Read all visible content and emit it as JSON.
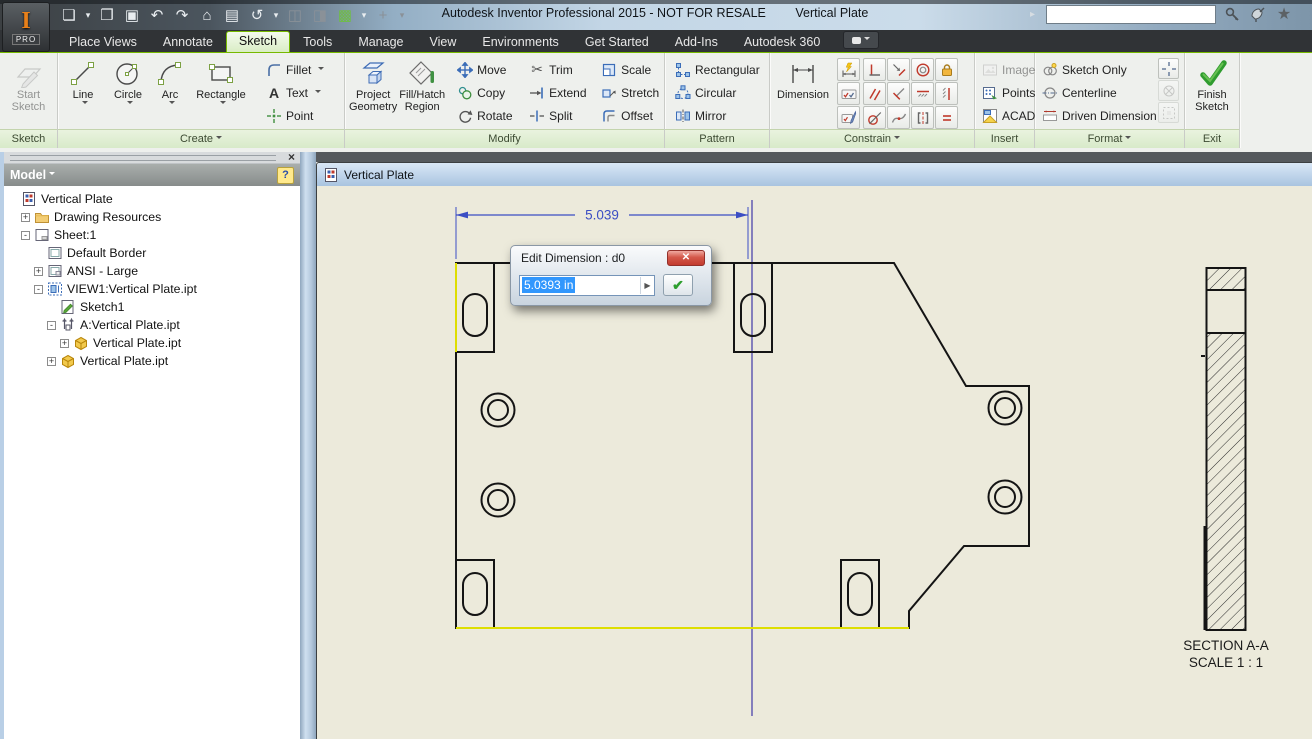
{
  "titlebar": {
    "app_name": "Autodesk Inventor Professional 2015 - NOT FOR RESALE",
    "doc_name": "Vertical Plate",
    "logo_letter": "I",
    "logo_sub": "PRO",
    "qat": [
      {
        "name": "new-file",
        "glyph": "❏"
      },
      {
        "name": "open-file",
        "glyph": "❒"
      },
      {
        "name": "save",
        "glyph": "▣"
      },
      {
        "name": "undo",
        "glyph": "↶"
      },
      {
        "name": "redo",
        "glyph": "↷"
      },
      {
        "name": "home",
        "glyph": "⌂"
      },
      {
        "name": "print",
        "glyph": "▤"
      },
      {
        "name": "update",
        "glyph": "↺"
      },
      {
        "name": "switch-window",
        "glyph": "◫"
      },
      {
        "name": "appearance",
        "glyph": "◨"
      },
      {
        "name": "component",
        "glyph": "▩"
      },
      {
        "name": "add-tool",
        "glyph": "+"
      },
      {
        "name": "customize-qat",
        "glyph": "▾"
      }
    ],
    "search": {
      "value": "",
      "go_glyph": "▸",
      "star_glyph": "★"
    }
  },
  "tabs": {
    "items": [
      "Place Views",
      "Annotate",
      "Sketch",
      "Tools",
      "Manage",
      "View",
      "Environments",
      "Get Started",
      "Add-Ins",
      "Autodesk 360"
    ],
    "active": "Sketch"
  },
  "ribbon": {
    "sketch": {
      "start": "Start Sketch",
      "footer": "Sketch"
    },
    "create": {
      "line": "Line",
      "circle": "Circle",
      "arc": "Arc",
      "rectangle": "Rectangle",
      "fillet": "Fillet",
      "text": "Text",
      "point": "Point",
      "text_glyph": "A",
      "footer": "Create"
    },
    "modify": {
      "project": "Project Geometry",
      "fill": "Fill/Hatch Region",
      "move": "Move",
      "copy": "Copy",
      "rotate": "Rotate",
      "trim": "Trim",
      "extend": "Extend",
      "split": "Split",
      "scale": "Scale",
      "stretch": "Stretch",
      "offset": "Offset",
      "trim_glyph": "✂",
      "footer": "Modify"
    },
    "pattern": {
      "rectangular": "Rectangular",
      "circular": "Circular",
      "mirror": "Mirror",
      "footer": "Pattern"
    },
    "constrain": {
      "dimension": "Dimension",
      "footer": "Constrain"
    },
    "insert": {
      "image": "Image",
      "points": "Points",
      "acad": "ACAD",
      "footer": "Insert"
    },
    "format": {
      "sketch_only": "Sketch Only",
      "centerline": "Centerline",
      "driven": "Driven Dimension",
      "footer": "Format"
    },
    "exit": {
      "finish": "Finish Sketch",
      "footer": "Exit"
    }
  },
  "browser": {
    "header": "Model",
    "help_glyph": "?",
    "close_glyph": "×",
    "tree": [
      {
        "label": "Vertical Plate",
        "expander": ""
      },
      {
        "label": "Drawing Resources",
        "expander": "+"
      },
      {
        "label": "Sheet:1",
        "expander": "-"
      },
      {
        "label": "Default Border",
        "expander": ""
      },
      {
        "label": "ANSI - Large",
        "expander": "+"
      },
      {
        "label": "VIEW1:Vertical Plate.ipt",
        "expander": "-"
      },
      {
        "label": "Sketch1",
        "expander": ""
      },
      {
        "label": "A:Vertical Plate.ipt",
        "expander": "-"
      },
      {
        "label": "Vertical Plate.ipt",
        "expander": "+"
      },
      {
        "label": "Vertical Plate.ipt",
        "expander": "+"
      }
    ]
  },
  "document": {
    "title": "Vertical Plate"
  },
  "drawing": {
    "dimension": "5.039",
    "section_title": "SECTION A-A",
    "section_scale": "SCALE 1 : 1"
  },
  "dialog": {
    "title": "Edit Dimension : d0",
    "value": "5.0393 in",
    "close_glyph": "✕",
    "ok_glyph": "✔",
    "flyout_glyph": "▶"
  },
  "colors": {
    "accent_green": "#76b900",
    "dimension_blue": "#3b4ec4",
    "sheet_beige": "#eceadb",
    "sketch_yellow": "#dede00",
    "construction_purple": "#4038a8"
  }
}
